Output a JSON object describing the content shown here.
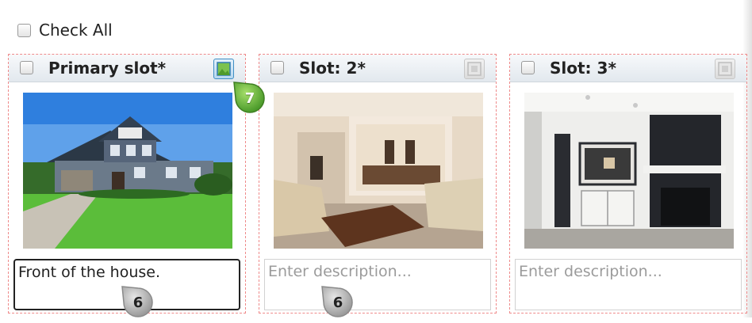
{
  "check_all": {
    "label": "Check All"
  },
  "slots": [
    {
      "title": "Primary slot*",
      "description": "Front of the house.",
      "placeholder": "Enter description..."
    },
    {
      "title": "Slot: 2*",
      "description": "",
      "placeholder": "Enter description..."
    },
    {
      "title": "Slot: 3*",
      "description": "",
      "placeholder": "Enter description..."
    }
  ],
  "callouts": {
    "green": "7",
    "gray_1": "6",
    "gray_2": "6"
  },
  "colors": {
    "slot_border": "#ef8a8a",
    "callout_green": "#5ab23a",
    "callout_gray": "#b5b5b5"
  },
  "icons": {
    "slot_checkbox": "checkbox-icon",
    "primary_toggle": "image-icon"
  }
}
